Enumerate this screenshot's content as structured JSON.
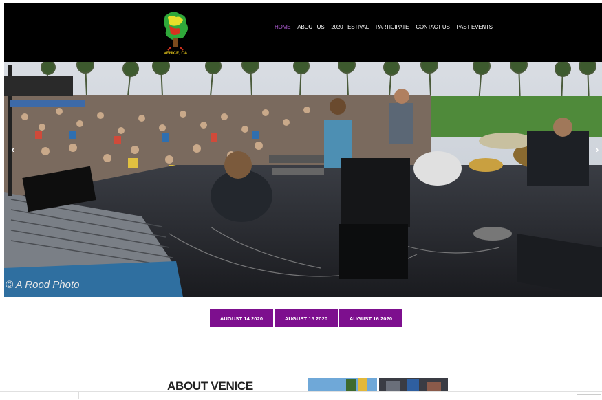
{
  "header": {
    "logo_text": "VENICE, CA",
    "nav": [
      {
        "label": "HOME",
        "active": true
      },
      {
        "label": "ABOUT US",
        "active": false
      },
      {
        "label": "2020 FESTIVAL",
        "active": false
      },
      {
        "label": "PARTICIPATE",
        "active": false
      },
      {
        "label": "CONTACT US",
        "active": false
      },
      {
        "label": "PAST EVENTS",
        "active": false
      }
    ]
  },
  "hero": {
    "watermark": "© A Rood Photo",
    "prev_icon": "chevron-left-icon",
    "next_icon": "chevron-right-icon"
  },
  "dates": [
    {
      "label": "AUGUST 14 2020"
    },
    {
      "label": "AUGUST 15 2020"
    },
    {
      "label": "AUGUST 16 2020"
    }
  ],
  "about": {
    "title": "ABOUT VENICE"
  },
  "colors": {
    "accent": "#7d0f8e",
    "nav_active": "#b05cd6",
    "header_bg": "#000000"
  }
}
